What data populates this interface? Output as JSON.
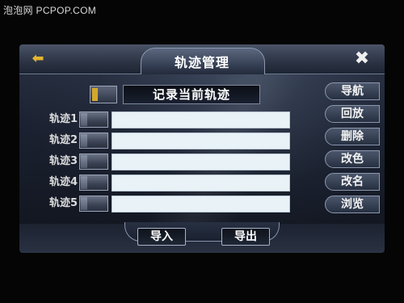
{
  "watermark": "泡泡网 PCPOP.COM",
  "header": {
    "title": "轨迹管理",
    "back_icon": "arrow-left-icon",
    "close_icon": "close-icon",
    "back_glyph": "⬅",
    "close_glyph": "✖"
  },
  "record": {
    "label": "记录当前轨迹",
    "indicator_color": "#d4a82a"
  },
  "tracks": [
    {
      "label": "轨迹1",
      "value": ""
    },
    {
      "label": "轨迹2",
      "value": ""
    },
    {
      "label": "轨迹3",
      "value": ""
    },
    {
      "label": "轨迹4",
      "value": ""
    },
    {
      "label": "轨迹5",
      "value": ""
    }
  ],
  "side_buttons": [
    {
      "label": "导航"
    },
    {
      "label": "回放"
    },
    {
      "label": "删除"
    },
    {
      "label": "改色"
    },
    {
      "label": "改名"
    },
    {
      "label": "浏览"
    }
  ],
  "bottom_buttons": {
    "import_label": "导入",
    "export_label": "导出"
  },
  "colors": {
    "accent": "#d4a82a",
    "field_bg": "#e9f2f7",
    "panel_dark": "#1b2130"
  }
}
